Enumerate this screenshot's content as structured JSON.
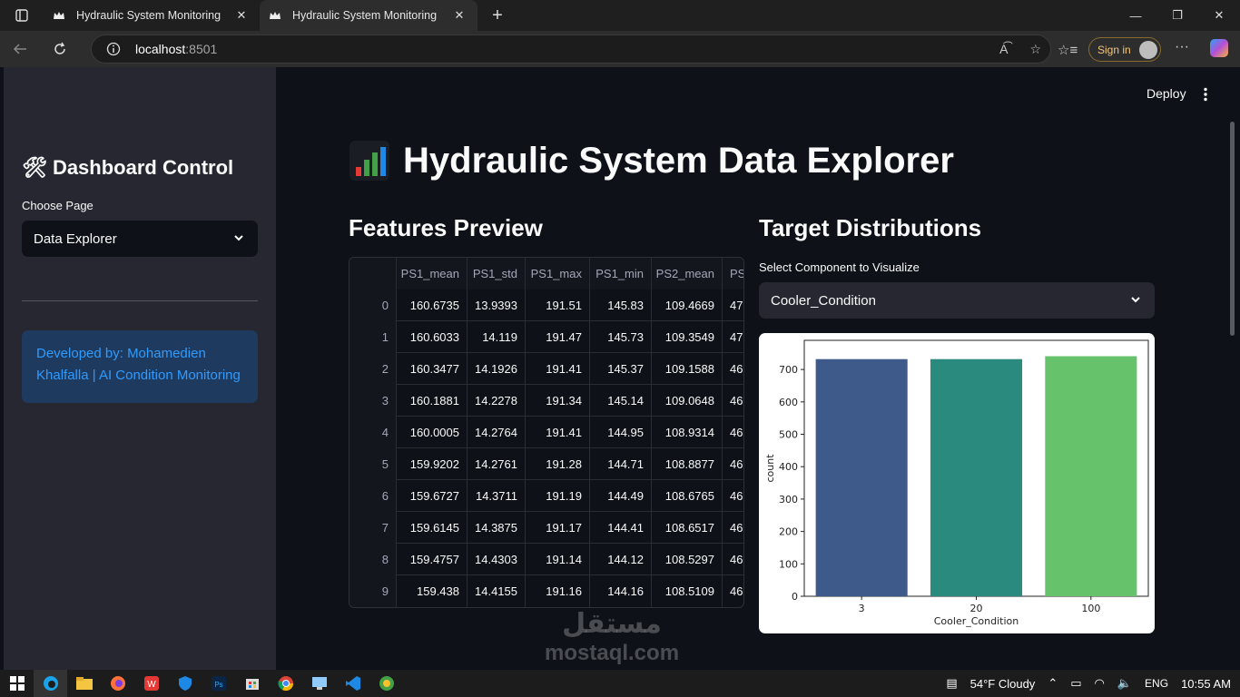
{
  "browser": {
    "tabs": [
      {
        "title": "Hydraulic System Monitoring"
      },
      {
        "title": "Hydraulic System Monitoring"
      }
    ],
    "url_host": "localhost",
    "url_port": ":8501",
    "sign_in": "Sign in"
  },
  "sidebar": {
    "title": "Dashboard Control",
    "choose_label": "Choose Page",
    "page_select": "Data Explorer",
    "info": "Developed by: Mohamedien Khalfalla | AI Condition Monitoring"
  },
  "header": {
    "deploy": "Deploy"
  },
  "main": {
    "title": "Hydraulic System Data Explorer",
    "preview_heading": "Features Preview",
    "target_heading": "Target Distributions",
    "select_label": "Select Component to Visualize",
    "select_value": "Cooler_Condition"
  },
  "table": {
    "columns": [
      "PS1_mean",
      "PS1_std",
      "PS1_max",
      "PS1_min",
      "PS2_mean",
      "PS"
    ],
    "rows": [
      {
        "idx": "0",
        "cells": [
          "160.6735",
          "13.9393",
          "191.51",
          "145.83",
          "109.4669",
          "47"
        ]
      },
      {
        "idx": "1",
        "cells": [
          "160.6033",
          "14.119",
          "191.47",
          "145.73",
          "109.3549",
          "47"
        ]
      },
      {
        "idx": "2",
        "cells": [
          "160.3477",
          "14.1926",
          "191.41",
          "145.37",
          "109.1588",
          "46"
        ]
      },
      {
        "idx": "3",
        "cells": [
          "160.1881",
          "14.2278",
          "191.34",
          "145.14",
          "109.0648",
          "46"
        ]
      },
      {
        "idx": "4",
        "cells": [
          "160.0005",
          "14.2764",
          "191.41",
          "144.95",
          "108.9314",
          "46"
        ]
      },
      {
        "idx": "5",
        "cells": [
          "159.9202",
          "14.2761",
          "191.28",
          "144.71",
          "108.8877",
          "46"
        ]
      },
      {
        "idx": "6",
        "cells": [
          "159.6727",
          "14.3711",
          "191.19",
          "144.49",
          "108.6765",
          "46"
        ]
      },
      {
        "idx": "7",
        "cells": [
          "159.6145",
          "14.3875",
          "191.17",
          "144.41",
          "108.6517",
          "46"
        ]
      },
      {
        "idx": "8",
        "cells": [
          "159.4757",
          "14.4303",
          "191.14",
          "144.12",
          "108.5297",
          "46"
        ]
      },
      {
        "idx": "9",
        "cells": [
          "159.438",
          "14.4155",
          "191.16",
          "144.16",
          "108.5109",
          "46"
        ]
      }
    ]
  },
  "chart_data": {
    "type": "bar",
    "categories": [
      "3",
      "20",
      "100"
    ],
    "values": [
      732,
      732,
      741
    ],
    "xlabel": "Cooler_Condition",
    "ylabel": "count",
    "ylim": [
      0,
      790
    ],
    "yticks": [
      0,
      100,
      200,
      300,
      400,
      500,
      600,
      700
    ],
    "colors": [
      "#3e5a8a",
      "#2a8a7e",
      "#66c36b"
    ]
  },
  "taskbar": {
    "weather": "54°F Cloudy",
    "lang": "ENG",
    "time": "10:55 AM"
  },
  "watermark": {
    "arabic": "مستقل",
    "latin": "mostaql.com"
  }
}
